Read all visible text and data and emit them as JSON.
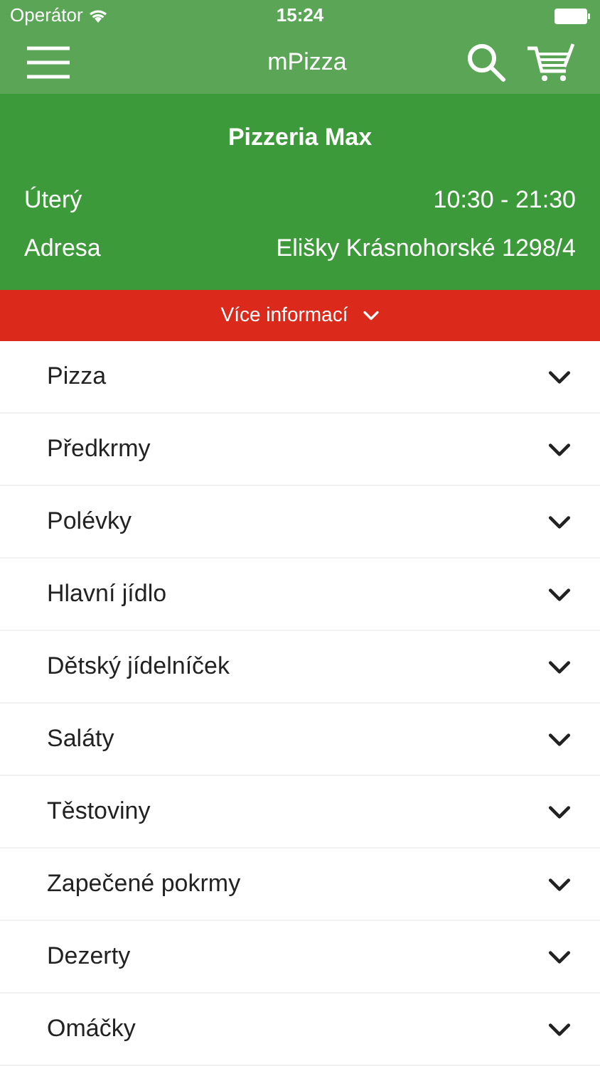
{
  "status_bar": {
    "carrier": "Operátor",
    "time": "15:24"
  },
  "nav": {
    "title": "mPizza"
  },
  "restaurant": {
    "name": "Pizzeria Max",
    "rows": [
      {
        "label": "Úterý",
        "value": "10:30 - 21:30"
      },
      {
        "label": "Adresa",
        "value": "Elišky Krásnohorské 1298/4"
      }
    ]
  },
  "more_button": {
    "label": "Více informací",
    "expanded": false
  },
  "categories": [
    {
      "label": "Pizza",
      "expanded": false
    },
    {
      "label": "Předkrmy",
      "expanded": false
    },
    {
      "label": "Polévky",
      "expanded": false
    },
    {
      "label": "Hlavní jídlo",
      "expanded": false
    },
    {
      "label": "Dětský jídelníček",
      "expanded": false
    },
    {
      "label": "Saláty",
      "expanded": false
    },
    {
      "label": "Těstoviny",
      "expanded": false
    },
    {
      "label": "Zapečené pokrmy",
      "expanded": false
    },
    {
      "label": "Dezerty",
      "expanded": false
    },
    {
      "label": "Omáčky",
      "expanded": false
    }
  ]
}
